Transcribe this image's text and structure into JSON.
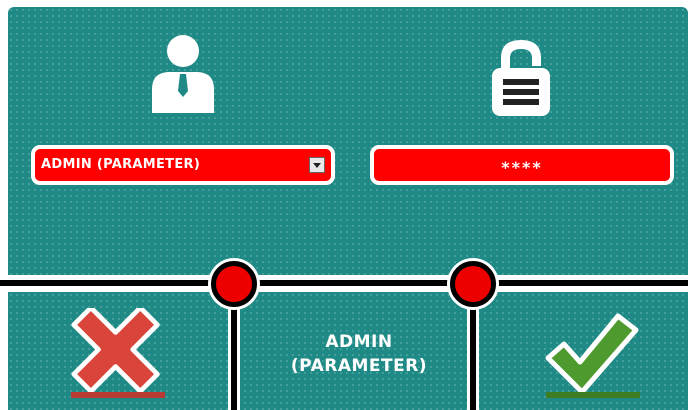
{
  "login": {
    "user_select_value": "ADMIN (PARAMETER)",
    "password_masked": "****",
    "current_user_line1": "ADMIN",
    "current_user_line2": "(PARAMETER)"
  },
  "icons": {
    "user": "user-icon",
    "lock": "padlock-icon",
    "cancel": "red-x-icon",
    "confirm": "green-check-icon"
  },
  "colors": {
    "panel": "#1f8a85",
    "field": "#ff0000",
    "node": "#ee0000",
    "cancel": "#d9453b",
    "confirm": "#4f9a2e"
  }
}
